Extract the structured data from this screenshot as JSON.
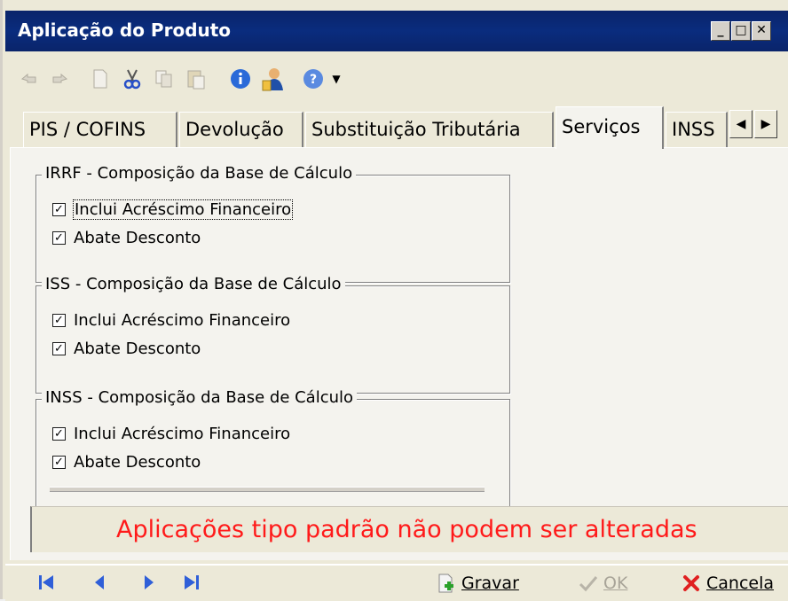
{
  "window": {
    "title": "Aplicação do Produto",
    "minimize": "_",
    "maximize": "□",
    "close": "✕"
  },
  "toolbar": {
    "icons": [
      "undo-icon",
      "redo-icon",
      "new-icon",
      "cut-icon",
      "copy-icon",
      "paste-icon",
      "info-icon",
      "user-icon",
      "help-icon",
      "dropdown-arrow-icon"
    ]
  },
  "tabs": {
    "items": [
      {
        "label": "PIS / COFINS",
        "active": false
      },
      {
        "label": "Devolução",
        "active": false
      },
      {
        "label": "Substituição Tributária",
        "active": false
      },
      {
        "label": "Serviços",
        "active": true
      },
      {
        "label": "INSS",
        "active": false
      }
    ],
    "scroll_left": "◀",
    "scroll_right": "▶"
  },
  "groups": [
    {
      "title": "IRRF - Composição da Base de Cálculo",
      "checks": [
        {
          "label": "Inclui Acréscimo Financeiro",
          "checked": true
        },
        {
          "label": "Abate Desconto",
          "checked": true
        }
      ]
    },
    {
      "title": "ISS - Composição da Base de Cálculo",
      "checks": [
        {
          "label": "Inclui Acréscimo Financeiro",
          "checked": true
        },
        {
          "label": "Abate Desconto",
          "checked": true
        }
      ]
    },
    {
      "title": "INSS - Composição da Base de Cálculo",
      "checks": [
        {
          "label": "Inclui Acréscimo Financeiro",
          "checked": true
        },
        {
          "label": "Abate Desconto",
          "checked": true
        }
      ]
    }
  ],
  "message": "Aplicações tipo padrão não podem ser alteradas",
  "bottom": {
    "first": "⏮",
    "prev": "◀",
    "next": "▶",
    "last": "⏭",
    "save_label": "Gravar",
    "ok_label": "OK",
    "cancel_label": "Cancela"
  },
  "colors": {
    "title_bar": "#0a246a",
    "message": "#ff1a1a",
    "nav": "#2f5fd8"
  }
}
